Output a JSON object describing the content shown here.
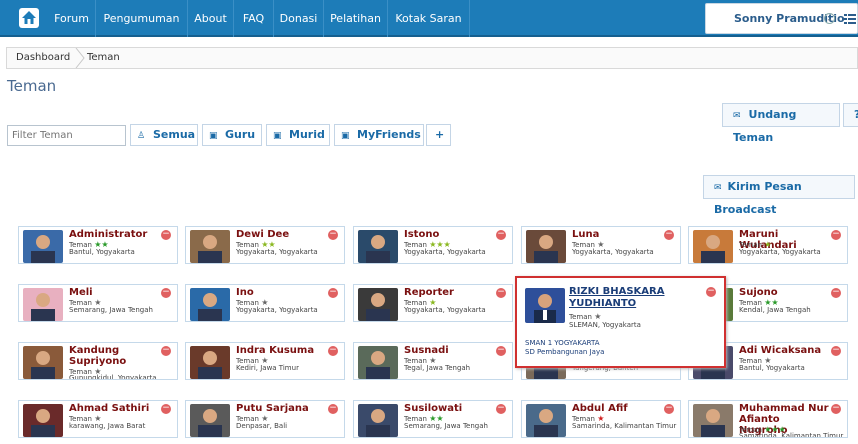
{
  "nav": {
    "items": [
      "Forum",
      "Pengumuman",
      "About",
      "FAQ",
      "Donasi",
      "Pelatihan",
      "Kotak Saran"
    ],
    "user_name": "Sonny Pramuditio",
    "user_dropdown_glyph": "⌄",
    "colors": {
      "bar": "#1d7cb8",
      "accent": "#1a6aa6"
    }
  },
  "breadcrumb": {
    "items": [
      "Dashboard",
      "Teman"
    ]
  },
  "page_title": "Teman",
  "filter": {
    "placeholder": "Filter Teman",
    "value": ""
  },
  "tabs": [
    {
      "label": "Semua",
      "icon": "person-icon"
    },
    {
      "label": "Guru",
      "icon": "list-icon"
    },
    {
      "label": "Murid",
      "icon": "list-icon"
    },
    {
      "label": "MyFriends",
      "icon": "list-icon"
    },
    {
      "label": "+",
      "icon": ""
    }
  ],
  "buttons": {
    "invite": "Undang Teman",
    "help": "?",
    "broadcast": "Kirim Pesan Broadcast"
  },
  "cards": [
    {
      "name": "Administrator",
      "role": "Teman",
      "stars": "★★",
      "star_color": "#2a9a2a",
      "location": "Bantul, Yogyakarta"
    },
    {
      "name": "Dewi Dee",
      "role": "Teman",
      "stars": "★★",
      "star_color": "#8ab820",
      "location": "Yogyakarta, Yogyakarta"
    },
    {
      "name": "Istono",
      "role": "Teman",
      "stars": "★★★",
      "star_color": "#8ab820",
      "location": "Yogyakarta, Yogyakarta"
    },
    {
      "name": "Luna",
      "role": "Teman",
      "stars": "★",
      "star_color": "#666666",
      "location": "Yogyakarta, Yogyakarta"
    },
    {
      "name": "Maruni Wulandari",
      "role": "Teman",
      "stars": "★",
      "star_color": "#8ab820",
      "location": "Yogyakarta, Yogyakarta"
    },
    {
      "name": "Meli",
      "role": "Teman",
      "stars": "★",
      "star_color": "#666666",
      "location": "Semarang, Jawa Tengah"
    },
    {
      "name": "Ino",
      "role": "Teman",
      "stars": "★",
      "star_color": "#666666",
      "location": "Yogyakarta, Yogyakarta"
    },
    {
      "name": "Reporter",
      "role": "Teman",
      "stars": "★",
      "star_color": "#8ab820",
      "location": "Yogyakarta, Yogyakarta"
    },
    {
      "name": "",
      "role": "",
      "stars": "",
      "star_color": "#666666",
      "location": ""
    },
    {
      "name": "Sujono",
      "role": "Teman",
      "stars": "★★",
      "star_color": "#2a9a2a",
      "location": "Kendal, Jawa Tengah"
    },
    {
      "name": "Kandung Supriyono",
      "role": "Teman",
      "stars": "★",
      "star_color": "#666666",
      "location": "Gunungkidul, Yogyakarta"
    },
    {
      "name": "Indra Kusuma",
      "role": "Teman",
      "stars": "★",
      "star_color": "#666666",
      "location": "Kediri, Jawa Timur"
    },
    {
      "name": "Susnadi",
      "role": "Teman",
      "stars": "★",
      "star_color": "#666666",
      "location": "Tegal, Jawa Tengah"
    },
    {
      "name": "",
      "role": "Teman",
      "stars": "★",
      "star_color": "#666666",
      "location": "Tangerang, Banten"
    },
    {
      "name": "Adi Wicaksana",
      "role": "Teman",
      "stars": "★",
      "star_color": "#666666",
      "location": "Bantul, Yogyakarta"
    },
    {
      "name": "Ahmad Sathiri",
      "role": "Teman",
      "stars": "★",
      "star_color": "#666666",
      "location": "karawang, Jawa Barat"
    },
    {
      "name": "Putu Sarjana",
      "role": "Teman",
      "stars": "★",
      "star_color": "#666666",
      "location": "Denpasar, Bali"
    },
    {
      "name": "Susilowati",
      "role": "Teman",
      "stars": "★★",
      "star_color": "#2a9a2a",
      "location": "Semarang, Jawa Tengah"
    },
    {
      "name": "Abdul Afif",
      "role": "Teman",
      "stars": "★",
      "star_color": "#d02020",
      "location": "Samarinda, Kalimantan Timur"
    },
    {
      "name": "Muhammad Nur Afianto Nugroho",
      "role": "Teman",
      "stars": "★★★",
      "star_color": "#2a9a2a",
      "location": "Samarinda, Kalimantan Timur"
    }
  ],
  "popup": {
    "name": "RIZKI BHASKARA YUDHIANTO",
    "role": "Teman",
    "stars": "★",
    "location": "SLEMAN, Yogyakarta",
    "school_1": "SMAN 1 YOGYAKARTA",
    "school_2": "SD Pembangunan Jaya"
  },
  "remove_glyph": "−"
}
